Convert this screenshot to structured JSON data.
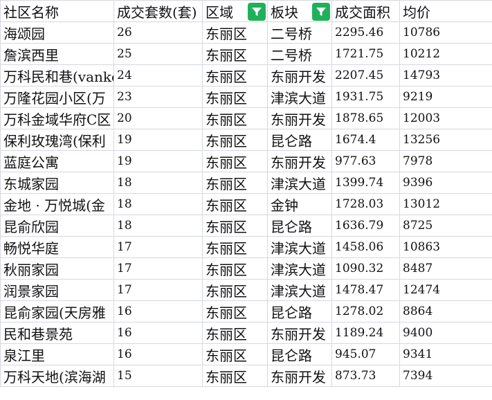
{
  "columns": [
    {
      "label": "社区名称",
      "filter": false
    },
    {
      "label": "成交套数(套)",
      "filter": false
    },
    {
      "label": "区域",
      "filter": true
    },
    {
      "label": "板块",
      "filter": true
    },
    {
      "label": "成交面积",
      "filter": false
    },
    {
      "label": "均价",
      "filter": false
    }
  ],
  "filter_icon": "funnel-icon",
  "accent_color": "#1fb15a",
  "rows": [
    [
      "海颂园",
      "26",
      "东丽区",
      "二号桥",
      "2295.46",
      "10786"
    ],
    [
      "詹滨西里",
      "25",
      "东丽区",
      "二号桥",
      "1721.75",
      "10212"
    ],
    [
      "万科民和巷(vanke",
      "24",
      "东丽区",
      "东丽开发",
      "2207.45",
      "14793"
    ],
    [
      "万隆花园小区(万",
      "23",
      "东丽区",
      "津滨大道",
      "1931.75",
      "9219"
    ],
    [
      "万科金域华府C区",
      "20",
      "东丽区",
      "东丽开发",
      "1878.65",
      "12003"
    ],
    [
      "保利玫瑰湾(保利",
      "19",
      "东丽区",
      "昆仑路",
      "1674.4",
      "13256"
    ],
    [
      "蓝庭公寓",
      "19",
      "东丽区",
      "东丽开发",
      "977.63",
      "7978"
    ],
    [
      "东城家园",
      "18",
      "东丽区",
      "津滨大道",
      "1399.74",
      "9396"
    ],
    [
      "金地 · 万悦城(金",
      "18",
      "东丽区",
      "金钟",
      "1728.03",
      "13012"
    ],
    [
      "昆俞欣园",
      "18",
      "东丽区",
      "昆仑路",
      "1636.79",
      "8725"
    ],
    [
      "畅悦华庭",
      "17",
      "东丽区",
      "津滨大道",
      "1458.06",
      "10863"
    ],
    [
      "秋丽家园",
      "17",
      "东丽区",
      "津滨大道",
      "1090.32",
      "8487"
    ],
    [
      "润景家园",
      "17",
      "东丽区",
      "津滨大道",
      "1478.47",
      "12474"
    ],
    [
      "昆俞家园(天房雅",
      "16",
      "东丽区",
      "昆仑路",
      "1278.02",
      "8864"
    ],
    [
      "民和巷景苑",
      "16",
      "东丽区",
      "东丽开发",
      "1189.24",
      "9400"
    ],
    [
      "泉江里",
      "16",
      "东丽区",
      "昆仑路",
      "945.07",
      "9341"
    ],
    [
      "万科天地(滨海湖",
      "15",
      "东丽区",
      "东丽开发",
      "873.73",
      "7394"
    ]
  ]
}
